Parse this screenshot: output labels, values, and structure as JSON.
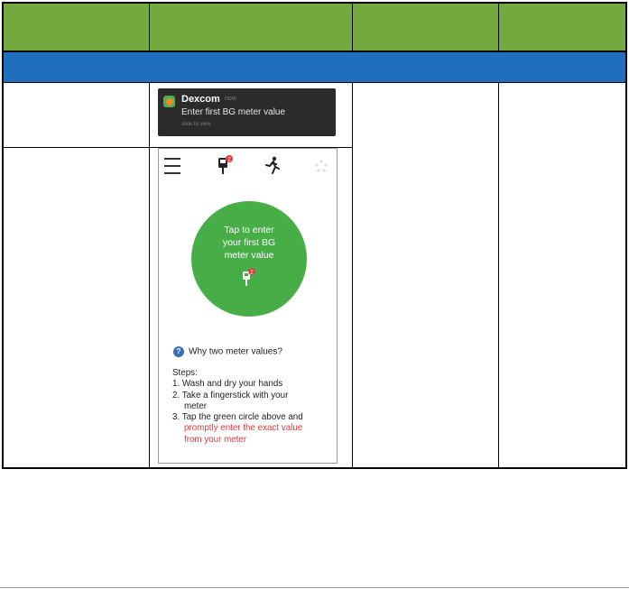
{
  "table": {
    "header_color": "#72aa3f",
    "section_color": "#1f6fbe",
    "headers": [
      "",
      "",
      "",
      ""
    ],
    "section_label": ""
  },
  "notification": {
    "app_name": "Dexcom",
    "time": "now",
    "message": "Enter first BG meter value",
    "subtext": "slide to view",
    "icon": "dexcom-app-icon"
  },
  "phone": {
    "top_icons": [
      "menu-icon",
      "blood-meter-icon",
      "exercise-runner-icon",
      "loading-dots-icon"
    ],
    "meter_badge": "2",
    "circle": {
      "lines": [
        "Tap to enter",
        "your first BG",
        "meter value"
      ],
      "badge": "2",
      "color": "#47ad46"
    },
    "why_label": "Why two meter values?",
    "steps_title": "Steps:",
    "step1": "1. Wash and dry your hands",
    "step2_a": "2. Take a fingerstick with your",
    "step2_b": "meter",
    "step3_a": "3. Tap the green circle above and",
    "step3_red_a": "promptly enter the exact value",
    "step3_red_b": "from your meter",
    "accent_red": "#e23a3a"
  }
}
